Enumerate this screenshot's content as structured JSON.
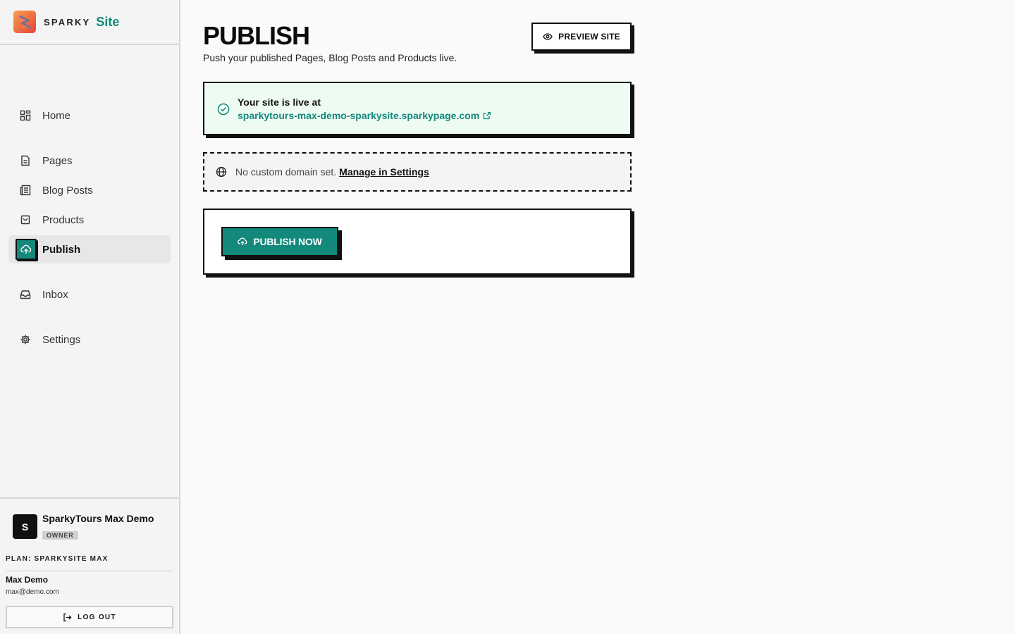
{
  "brand": {
    "sparky": "SPARKY",
    "site": "Site"
  },
  "nav": {
    "items": [
      {
        "label": "Home",
        "icon": "grid-icon"
      },
      {
        "label": "Pages",
        "icon": "document-icon"
      },
      {
        "label": "Blog Posts",
        "icon": "newspaper-icon"
      },
      {
        "label": "Products",
        "icon": "shopping-bag-icon"
      },
      {
        "label": "Publish",
        "icon": "cloud-upload-icon",
        "active": true
      },
      {
        "label": "Inbox",
        "icon": "inbox-icon"
      },
      {
        "label": "Settings",
        "icon": "gear-icon"
      }
    ]
  },
  "account": {
    "avatar_letter": "S",
    "org_name": "SparkyTours Max Demo",
    "role": "OWNER",
    "plan": "PLAN: SPARKYSITE MAX",
    "user_name": "Max Demo",
    "email": "max@demo.com",
    "logout_label": "LOG OUT"
  },
  "main": {
    "title": "PUBLISH",
    "subtitle": "Push your published Pages, Blog Posts and Products live.",
    "preview_label": "PREVIEW SITE",
    "live": {
      "title": "Your site is live at",
      "url": "sparkytours-max-demo-sparkysite.sparkypage.com"
    },
    "domain": {
      "text": "No custom domain set.",
      "link": "Manage in Settings"
    },
    "publish_label": "PUBLISH NOW"
  },
  "colors": {
    "accent": "#13897b",
    "live_bg": "#eefbf3",
    "border": "#111111"
  }
}
